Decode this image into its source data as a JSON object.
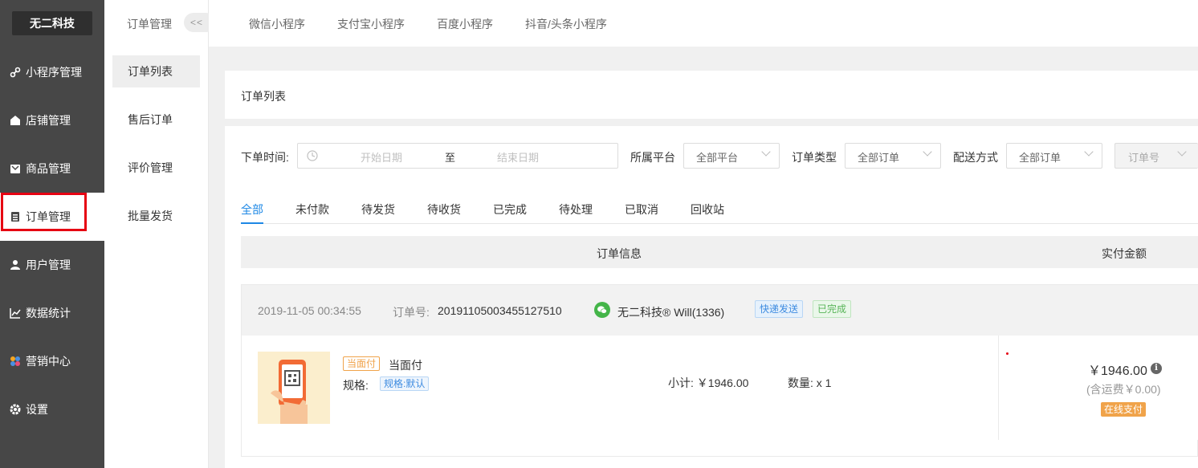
{
  "brand": "无二科技",
  "sidebar": {
    "items": [
      {
        "label": "小程序管理",
        "icon": "link-icon"
      },
      {
        "label": "店铺管理",
        "icon": "shop-icon"
      },
      {
        "label": "商品管理",
        "icon": "goods-icon"
      },
      {
        "label": "订单管理",
        "icon": "order-icon"
      },
      {
        "label": "用户管理",
        "icon": "user-icon"
      },
      {
        "label": "数据统计",
        "icon": "chart-icon"
      },
      {
        "label": "营销中心",
        "icon": "marketing-icon"
      },
      {
        "label": "设置",
        "icon": "gear-icon"
      }
    ],
    "active_index": 3,
    "highlight_color": "#e60012"
  },
  "subnav": {
    "title": "订单管理",
    "collapse_label": "<<",
    "items": [
      "订单列表",
      "售后订单",
      "评价管理",
      "批量发货"
    ],
    "active_index": 0
  },
  "top_tabs": [
    "微信小程序",
    "支付宝小程序",
    "百度小程序",
    "抖音/头条小程序"
  ],
  "panel": {
    "title": "订单列表"
  },
  "filters": {
    "time_label": "下单时间:",
    "start_placeholder": "开始日期",
    "to_label": "至",
    "end_placeholder": "结束日期",
    "platform_label": "所属平台",
    "platform_value": "全部平台",
    "type_label": "订单类型",
    "type_value": "全部订单",
    "delivery_label": "配送方式",
    "delivery_value": "全部订单",
    "order_no_placeholder": "订单号"
  },
  "status_tabs": [
    "全部",
    "未付款",
    "待发货",
    "待收货",
    "已完成",
    "待处理",
    "已取消",
    "回收站"
  ],
  "table": {
    "col_info": "订单信息",
    "col_amount": "实付金额"
  },
  "order": {
    "datetime": "2019-11-05 00:34:55",
    "order_no_label": "订单号:",
    "order_no": "20191105003455127510",
    "customer": "无二科技® Will(1336)",
    "tag_delivery": "快递发送",
    "tag_status": "已完成",
    "item_badge": "当面付",
    "item_name": "当面付",
    "spec_label": "规格:",
    "spec_value": "规格:默认",
    "subtotal": "小计: ￥1946.00",
    "quantity": "数量: x 1",
    "price": "￥1946.00",
    "shipping_note": "(含运费￥0.00)",
    "pay_method": "在线支付"
  },
  "colors": {
    "sidebar_bg": "#474747",
    "accent_blue": "#1e88e5",
    "wechat_green": "#44b549",
    "orange": "#f0a34a"
  }
}
